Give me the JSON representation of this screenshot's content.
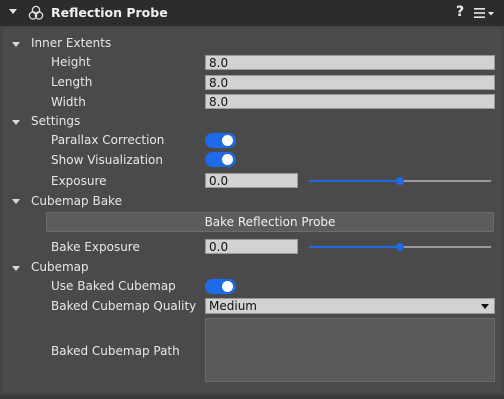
{
  "component": {
    "title": "Reflection Probe",
    "help_label": "?",
    "icon": "reflection-probe-icon"
  },
  "inner_extents": {
    "title": "Inner Extents",
    "height_label": "Height",
    "height_value": "8.0",
    "length_label": "Length",
    "length_value": "8.0",
    "width_label": "Width",
    "width_value": "8.0"
  },
  "settings": {
    "title": "Settings",
    "parallax_label": "Parallax Correction",
    "parallax_on": true,
    "show_vis_label": "Show Visualization",
    "show_vis_on": true,
    "exposure_label": "Exposure",
    "exposure_value": "0.0",
    "exposure_slider_fraction": 0.5
  },
  "cubemap_bake": {
    "title": "Cubemap Bake",
    "bake_button_label": "Bake Reflection Probe",
    "bake_exposure_label": "Bake Exposure",
    "bake_exposure_value": "0.0",
    "bake_exposure_slider_fraction": 0.5
  },
  "cubemap": {
    "title": "Cubemap",
    "use_baked_label": "Use Baked Cubemap",
    "use_baked_on": true,
    "quality_label": "Baked Cubemap Quality",
    "quality_value": "Medium",
    "path_label": "Baked Cubemap Path"
  },
  "colors": {
    "accent": "#1e6bea",
    "header_bg": "#2c2c2c",
    "panel_bg": "#4a4a4a"
  }
}
